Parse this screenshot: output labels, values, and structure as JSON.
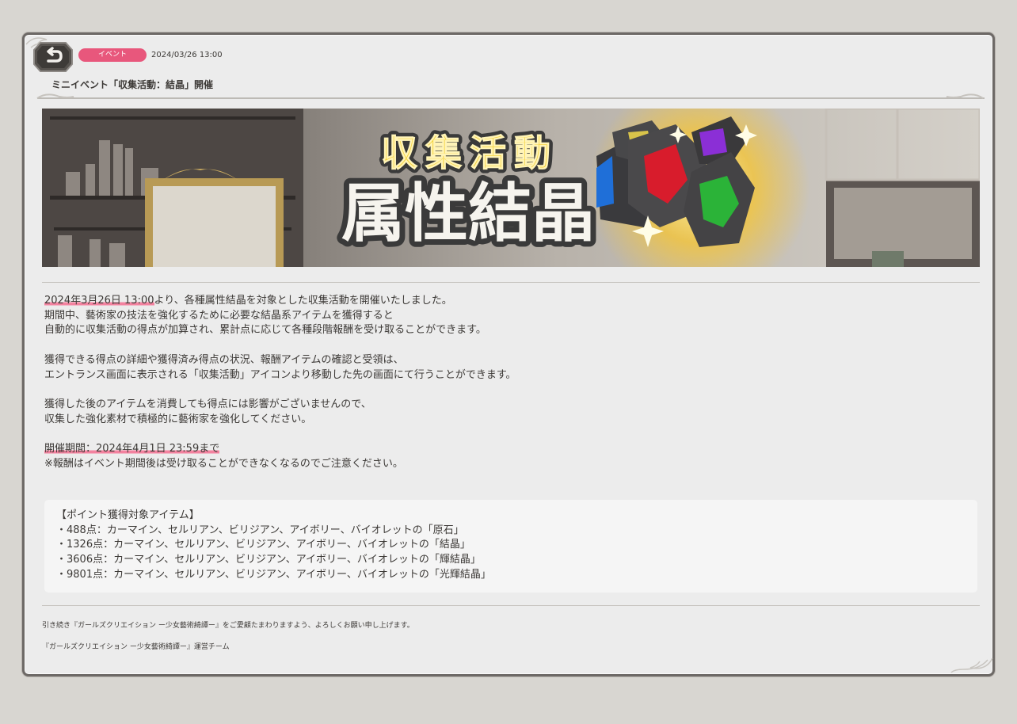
{
  "notice": {
    "category_badge": "イベント",
    "date": "2024/03/26 13:00",
    "title": "ミニイベント「収集活動：結晶」開催",
    "badge_color": "#e8577c"
  },
  "banner": {
    "line1": "収集活動",
    "line2": "属性結晶",
    "gem_colors": [
      "#d81c2c",
      "#2bb338",
      "#8b2fd6",
      "#1f6fd8",
      "#d8c34a"
    ]
  },
  "body": {
    "p1_highlight": "2024年3月26日 13:00",
    "p1_rest": "より、各種属性結晶を対象とした収集活動を開催いたしました。",
    "p1_line2": "期間中、藝術家の技法を強化するために必要な結晶系アイテムを獲得すると",
    "p1_line3": "自動的に収集活動の得点が加算され、累計点に応じて各種段階報酬を受け取ることができます。",
    "p2_line1": "獲得できる得点の詳細や獲得済み得点の状況、報酬アイテムの確認と受領は、",
    "p2_line2": "エントランス画面に表示される「収集活動」アイコンより移動した先の画面にて行うことができます。",
    "p3_line1": "獲得した後のアイテムを消費しても得点には影響がございませんので、",
    "p3_line2": "収集した強化素材で積極的に藝術家を強化してください。",
    "period_highlight": "開催期間：2024年4月1日 23:59まで",
    "period_note": "※報酬はイベント期間後は受け取ることができなくなるのでご注意ください。"
  },
  "items": {
    "heading": "【ポイント獲得対象アイテム】",
    "list": [
      "・488点：カーマイン、セルリアン、ビリジアン、アイボリー、バイオレットの「原石」",
      "・1326点：カーマイン、セルリアン、ビリジアン、アイボリー、バイオレットの「結晶」",
      "・3606点：カーマイン、セルリアン、ビリジアン、アイボリー、バイオレットの「輝結晶」",
      "・9801点：カーマイン、セルリアン、ビリジアン、アイボリー、バイオレットの「光輝結晶」"
    ]
  },
  "footer": {
    "line1": "引き続き『ガールズクリエイション ー少女藝術綺譚ー』をご愛顧たまわりますよう、よろしくお願い申し上げます。",
    "line2": "『ガールズクリエイション ー少女藝術綺譚ー』運営チーム"
  }
}
